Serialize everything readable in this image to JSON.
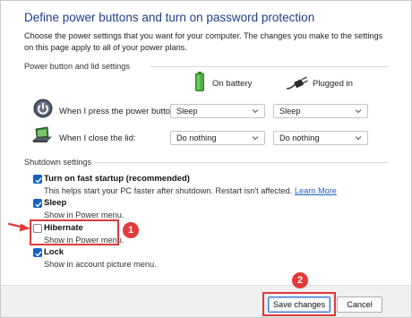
{
  "page": {
    "title": "Define power buttons and turn on password protection",
    "description": "Choose the power settings that you want for your computer. The changes you make to the settings on this page apply to all of your power plans."
  },
  "power_section": {
    "header": "Power button and lid settings",
    "col_battery": "On battery",
    "col_plugged": "Plugged in",
    "rows": [
      {
        "label": "When I press the power button:",
        "battery": "Sleep",
        "plugged": "Sleep",
        "icon": "power-button-icon"
      },
      {
        "label": "When I close the lid:",
        "battery": "Do nothing",
        "plugged": "Do nothing",
        "icon": "laptop-lid-icon"
      }
    ]
  },
  "shutdown_section": {
    "header": "Shutdown settings",
    "options": [
      {
        "title": "Turn on fast startup (recommended)",
        "sub": "This helps start your PC faster after shutdown. Restart isn't affected.",
        "link": "Learn More",
        "checked": true
      },
      {
        "title": "Sleep",
        "sub": "Show in Power menu.",
        "checked": true
      },
      {
        "title": "Hibernate",
        "sub": "Show in Power menu.",
        "checked": false
      },
      {
        "title": "Lock",
        "sub": "Show in account picture menu.",
        "checked": true
      }
    ]
  },
  "footer": {
    "save_label": "Save changes",
    "cancel_label": "Cancel"
  },
  "annotations": {
    "badge1": "1",
    "badge2": "2",
    "color": "#e33a3a"
  },
  "colors": {
    "title": "#1e3f8a",
    "checkbox": "#1464c8",
    "link": "#1f5fbf"
  }
}
